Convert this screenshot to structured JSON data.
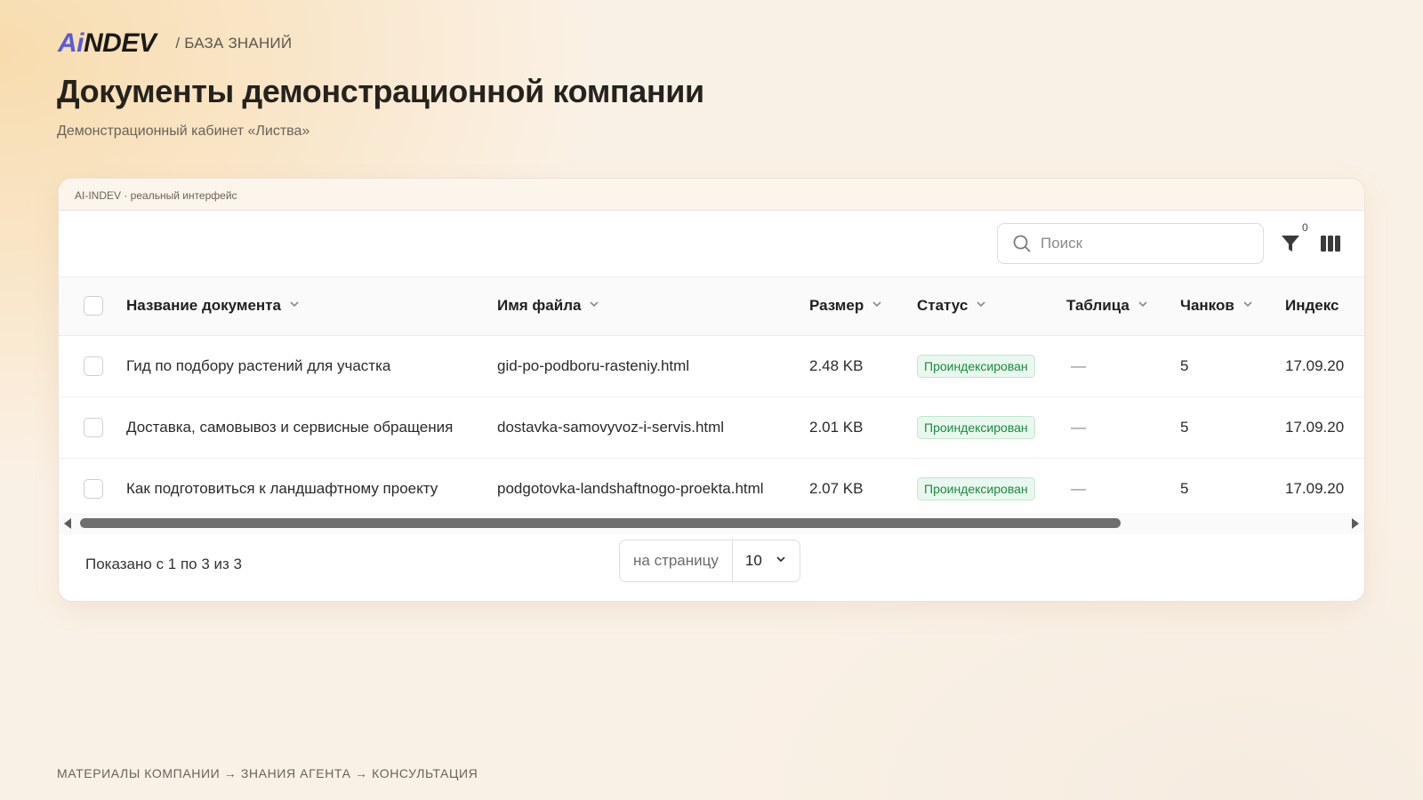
{
  "brand": {
    "logo_ai": "Ai",
    "logo_rest": "NDEV",
    "section": "/ БАЗА ЗНАНИЙ"
  },
  "page": {
    "title": "Документы демонстрационной компании",
    "subtitle": "Демонстрационный кабинет «Листва»"
  },
  "panel": {
    "caption": "AI-INDEV · реальный интерфейс"
  },
  "toolbar": {
    "search_placeholder": "Поиск",
    "filter_count": "0"
  },
  "table": {
    "columns": [
      "Название документа",
      "Имя файла",
      "Размер",
      "Статус",
      "Таблица",
      "Чанков",
      "Индекс"
    ],
    "rows": [
      {
        "name": "Гид по подбору растений для участка",
        "file": "gid-po-podboru-rasteniy.html",
        "size": "2.48 KB",
        "status": "Проиндексирован",
        "table": "—",
        "chunks": "5",
        "index": "17.09.20"
      },
      {
        "name": "Доставка, самовывоз и сервисные обращения",
        "file": "dostavka-samovyvoz-i-servis.html",
        "size": "2.01 KB",
        "status": "Проиндексирован",
        "table": "—",
        "chunks": "5",
        "index": "17.09.20"
      },
      {
        "name": "Как подготовиться к ландшафтному проекту",
        "file": "podgotovka-landshaftnogo-proekta.html",
        "size": "2.07 KB",
        "status": "Проиндексирован",
        "table": "—",
        "chunks": "5",
        "index": "17.09.20"
      }
    ]
  },
  "pagination": {
    "shown": "Показано с 1 по 3 из 3",
    "per_page_label": "на страницу",
    "per_page_value": "10"
  },
  "flow": "МАТЕРИАЛЫ КОМПАНИИ → ЗНАНИЯ АГЕНТА → КОНСУЛЬТАЦИЯ",
  "colors": {
    "brand_accent": "#5b5bd6",
    "status_green": "#1a8a3e",
    "status_bg": "#e9f8ee"
  }
}
